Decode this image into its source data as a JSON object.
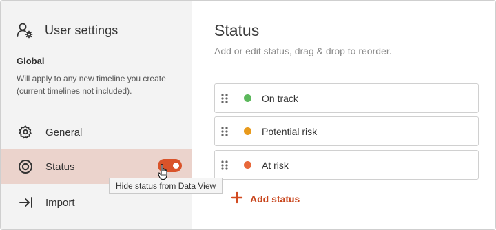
{
  "sidebar": {
    "title": "User settings",
    "title_icon": "user-settings-icon",
    "global_title": "Global",
    "global_description": "Will apply to any new timeline you create (current timelines not included).",
    "items": [
      {
        "label": "General",
        "icon": "gear-icon"
      },
      {
        "label": "Status",
        "icon": "status-icon",
        "active": true,
        "toggle_on": true
      },
      {
        "label": "Import",
        "icon": "import-icon"
      }
    ],
    "tooltip": "Hide status from Data View"
  },
  "main": {
    "title": "Status",
    "subtitle": "Add or edit status, drag & drop to reorder.",
    "statuses": [
      {
        "label": "On track",
        "color": "#5cb85c"
      },
      {
        "label": "Potential risk",
        "color": "#e89a1c"
      },
      {
        "label": "At risk",
        "color": "#e8683a"
      }
    ],
    "add_label": "Add status"
  },
  "colors": {
    "accent": "#d9532a",
    "active_bg": "#ebd3cc",
    "sidebar_bg": "#f3f3f3"
  }
}
